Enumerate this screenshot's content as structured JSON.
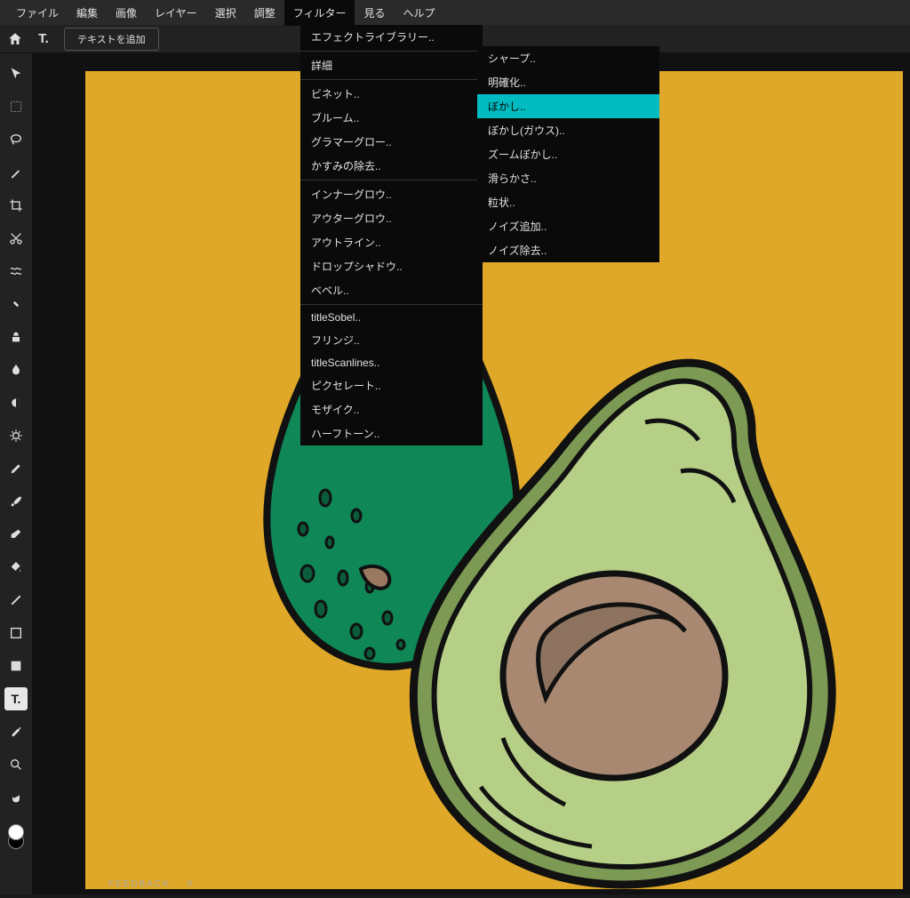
{
  "menubar": {
    "file": "ファイル",
    "edit": "編集",
    "image": "画像",
    "layer": "レイヤー",
    "select": "選択",
    "adjust": "調整",
    "filter": "フィルター",
    "view": "見る",
    "help": "ヘルプ"
  },
  "subbar": {
    "add_text": "テキストを追加"
  },
  "filter_menu": {
    "effect_library": "エフェクトライブラリー..",
    "details": "詳細",
    "vignette": "ビネット..",
    "bloom": "ブルーム..",
    "glamour_glow": "グラマーグロー..",
    "dehaze": "かすみの除去..",
    "inner_glow": "インナーグロウ..",
    "outer_glow": "アウターグロウ..",
    "outline": "アウトライン..",
    "drop_shadow": "ドロップシャドウ..",
    "bevel": "ベベル..",
    "sobel": "titleSobel..",
    "fringe": "フリンジ..",
    "scanlines": "titleScanlines..",
    "pixelate": "ピクセレート..",
    "mosaic": "モザイク..",
    "halftone": "ハーフトーン.."
  },
  "details_submenu": {
    "sharpen": "シャープ..",
    "clarity": "明確化..",
    "blur": "ぼかし..",
    "gaussian_blur": "ぼかし(ガウス)..",
    "zoom_blur": "ズームぼかし..",
    "smooth": "滑らかさ..",
    "grain": "粒状..",
    "add_noise": "ノイズ追加..",
    "remove_noise": "ノイズ除去.."
  },
  "feedback": {
    "label": "FEEDBACK",
    "close": "X"
  },
  "canvas": {
    "bg_color": "#e0a828"
  },
  "tools": [
    "arrow",
    "marquee",
    "lasso",
    "wand",
    "crop",
    "cut",
    "liquify",
    "heal",
    "clone",
    "blur",
    "dodge",
    "sponge",
    "eyedrop",
    "brush",
    "eraser",
    "fill",
    "gradient",
    "shape",
    "frame",
    "text",
    "picker",
    "zoom",
    "hand"
  ]
}
